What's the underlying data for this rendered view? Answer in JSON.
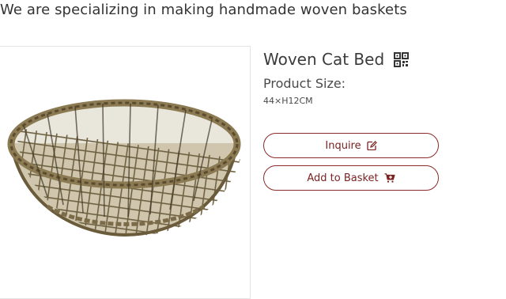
{
  "header": {
    "tagline": "We are specializing in making handmade woven baskets"
  },
  "product": {
    "image_alt": "woven basket",
    "title": "Woven Cat Bed",
    "title_icon": "qr-code-icon",
    "size_label": "Product Size:",
    "size_value": "44×H12CM"
  },
  "actions": {
    "inquire_label": "Inquire",
    "inquire_icon": "edit-icon",
    "basket_label": "Add to Basket",
    "basket_icon": "cart-plus-icon",
    "accent_color": "#8c2a2a"
  }
}
